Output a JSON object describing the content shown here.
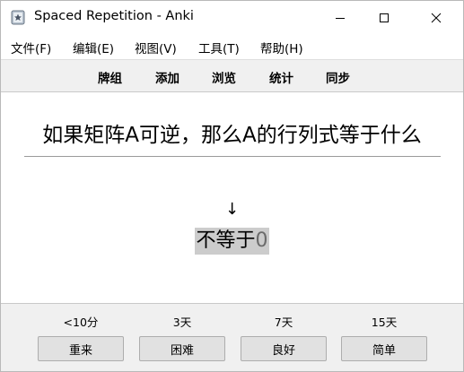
{
  "window": {
    "title": "Spaced Repetition - Anki"
  },
  "menu": {
    "items": [
      {
        "label": "文件(F)"
      },
      {
        "label": "编辑(E)"
      },
      {
        "label": "视图(V)"
      },
      {
        "label": "工具(T)"
      },
      {
        "label": "帮助(H)"
      }
    ]
  },
  "toolbar": {
    "items": [
      {
        "label": "牌组"
      },
      {
        "label": "添加"
      },
      {
        "label": "浏览"
      },
      {
        "label": "统计"
      },
      {
        "label": "同步"
      }
    ]
  },
  "card": {
    "question": "如果矩阵A可逆，那么A的行列式等于什么",
    "arrow": "↓",
    "answer_text": "不等于",
    "answer_number": "0"
  },
  "answer_buttons": [
    {
      "interval": "<10分",
      "label": "重来"
    },
    {
      "interval": "3天",
      "label": "困难"
    },
    {
      "interval": "7天",
      "label": "良好"
    },
    {
      "interval": "15天",
      "label": "简单"
    }
  ],
  "colors": {
    "toolbar_bg": "#f0f0f0",
    "answer_highlight": "#cccccc",
    "button_bg": "#e1e1e1"
  },
  "icons": [
    "anki-app-icon",
    "minimize-icon",
    "maximize-icon",
    "close-icon"
  ]
}
